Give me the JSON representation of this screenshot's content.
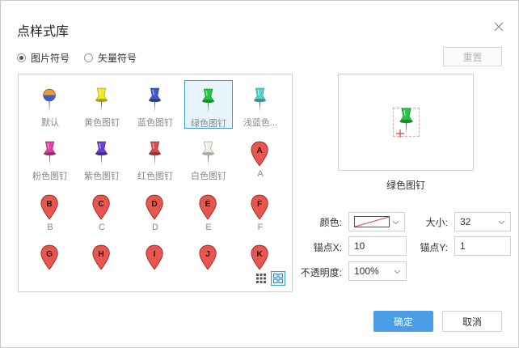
{
  "dialog": {
    "title": "点样式库",
    "reset_label": "重置",
    "ok_label": "确定",
    "cancel_label": "取消"
  },
  "symbol_type": {
    "options": [
      "图片符号",
      "矢量符号"
    ],
    "selected": "图片符号"
  },
  "symbols": [
    {
      "label": "默认",
      "kind": "default"
    },
    {
      "label": "黄色图钉",
      "kind": "pushpin",
      "color": "#f2ea1c"
    },
    {
      "label": "蓝色图钉",
      "kind": "pushpin",
      "color": "#3a5bd0"
    },
    {
      "label": "绿色图钉",
      "kind": "pushpin",
      "color": "#22c93c",
      "selected": true
    },
    {
      "label": "浅蓝色...",
      "kind": "pushpin",
      "color": "#4fd3d0"
    },
    {
      "label": "粉色图钉",
      "kind": "pushpin",
      "color": "#e03fa6"
    },
    {
      "label": "紫色图钉",
      "kind": "pushpin",
      "color": "#6b3fd6"
    },
    {
      "label": "红色图钉",
      "kind": "pushpin",
      "color": "#d94b4b"
    },
    {
      "label": "白色图钉",
      "kind": "pushpin",
      "color": "#f0f0ea"
    },
    {
      "label": "A",
      "kind": "marker",
      "letter": "A"
    },
    {
      "label": "B",
      "kind": "marker",
      "letter": "B"
    },
    {
      "label": "C",
      "kind": "marker",
      "letter": "C"
    },
    {
      "label": "D",
      "kind": "marker",
      "letter": "D"
    },
    {
      "label": "E",
      "kind": "marker",
      "letter": "E"
    },
    {
      "label": "F",
      "kind": "marker",
      "letter": "F"
    },
    {
      "label": "",
      "kind": "marker",
      "letter": "G"
    },
    {
      "label": "",
      "kind": "marker",
      "letter": "H"
    },
    {
      "label": "",
      "kind": "marker",
      "letter": "I"
    },
    {
      "label": "",
      "kind": "marker",
      "letter": "J"
    },
    {
      "label": "",
      "kind": "marker",
      "letter": "K"
    }
  ],
  "preview": {
    "name": "绿色图钉",
    "color": "#22c93c"
  },
  "properties": {
    "color_label": "颜色:",
    "size_label": "大小:",
    "size_value": "32",
    "anchor_x_label": "锚点X:",
    "anchor_x_value": "10",
    "anchor_y_label": "锚点Y:",
    "anchor_y_value": "1",
    "opacity_label": "不透明度:",
    "opacity_value": "100%"
  },
  "colors": {
    "accent": "#4a9de6",
    "marker_red": "#e8574f",
    "selection": "#3d9bd6"
  },
  "icons": {
    "close": "close-icon",
    "grid_small": "grid-small-icon",
    "grid_large": "grid-large-icon"
  }
}
